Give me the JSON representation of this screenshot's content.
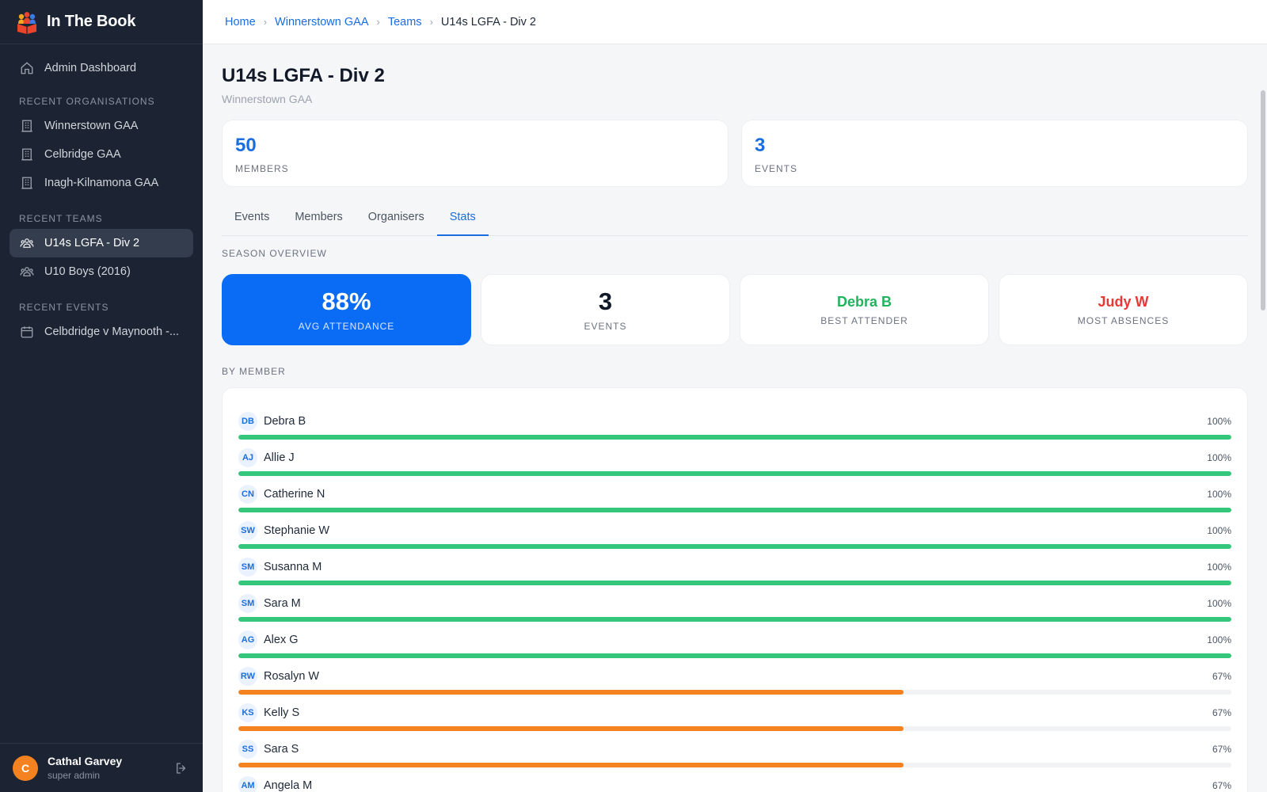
{
  "app": {
    "name": "In The Book"
  },
  "sidebar": {
    "dashboard_label": "Admin Dashboard",
    "recent_orgs_heading": "RECENT ORGANISATIONS",
    "orgs": [
      "Winnerstown GAA",
      "Celbridge GAA",
      "Inagh-Kilnamona GAA"
    ],
    "recent_teams_heading": "RECENT TEAMS",
    "teams": [
      "U14s LGFA - Div 2",
      "U10 Boys (2016)"
    ],
    "recent_events_heading": "RECENT EVENTS",
    "events": [
      "Celbdridge v Maynooth -..."
    ],
    "user": {
      "initial": "C",
      "name": "Cathal Garvey",
      "role": "super admin"
    }
  },
  "breadcrumb": {
    "home": "Home",
    "org": "Winnerstown GAA",
    "teams": "Teams",
    "current": "U14s LGFA - Div 2",
    "sep": "›"
  },
  "header": {
    "title": "U14s LGFA - Div 2",
    "subtitle": "Winnerstown GAA"
  },
  "summary": {
    "members_count": "50",
    "members_label": "MEMBERS",
    "events_count": "3",
    "events_label": "EVENTS"
  },
  "tabs": [
    "Events",
    "Members",
    "Organisers",
    "Stats"
  ],
  "active_tab": "Stats",
  "stats": {
    "section_label": "SEASON OVERVIEW",
    "avg_attendance": "88%",
    "avg_attendance_label": "AVG ATTENDANCE",
    "events": "3",
    "events_label": "EVENTS",
    "best_attender": "Debra B",
    "best_attender_label": "BEST ATTENDER",
    "most_absences": "Judy W",
    "most_absences_label": "MOST ABSENCES"
  },
  "by_member": {
    "section_label": "BY MEMBER",
    "members": [
      {
        "initials": "DB",
        "name": "Debra B",
        "pct_label": "100%",
        "pct": 100
      },
      {
        "initials": "AJ",
        "name": "Allie J",
        "pct_label": "100%",
        "pct": 100
      },
      {
        "initials": "CN",
        "name": "Catherine N",
        "pct_label": "100%",
        "pct": 100
      },
      {
        "initials": "SW",
        "name": "Stephanie W",
        "pct_label": "100%",
        "pct": 100
      },
      {
        "initials": "SM",
        "name": "Susanna M",
        "pct_label": "100%",
        "pct": 100
      },
      {
        "initials": "SM",
        "name": "Sara M",
        "pct_label": "100%",
        "pct": 100
      },
      {
        "initials": "AG",
        "name": "Alex G",
        "pct_label": "100%",
        "pct": 100
      },
      {
        "initials": "RW",
        "name": "Rosalyn W",
        "pct_label": "67%",
        "pct": 67
      },
      {
        "initials": "KS",
        "name": "Kelly S",
        "pct_label": "67%",
        "pct": 67
      },
      {
        "initials": "SS",
        "name": "Sara S",
        "pct_label": "67%",
        "pct": 67
      },
      {
        "initials": "AM",
        "name": "Angela M",
        "pct_label": "67%",
        "pct": 67
      }
    ]
  },
  "colors": {
    "accent": "#1a6ee0",
    "primary_card": "#0a6cf5",
    "full_attendance": "#34c77b",
    "partial_attendance": "#f58220",
    "best": "#22b35e",
    "worst": "#e53935",
    "sidebar_bg": "#1c2433"
  },
  "icons": {
    "dashboard": "home-icon",
    "org": "building-icon",
    "team": "users-icon",
    "event": "calendar-icon",
    "logout": "logout-icon",
    "logo": "book-people-logo"
  }
}
